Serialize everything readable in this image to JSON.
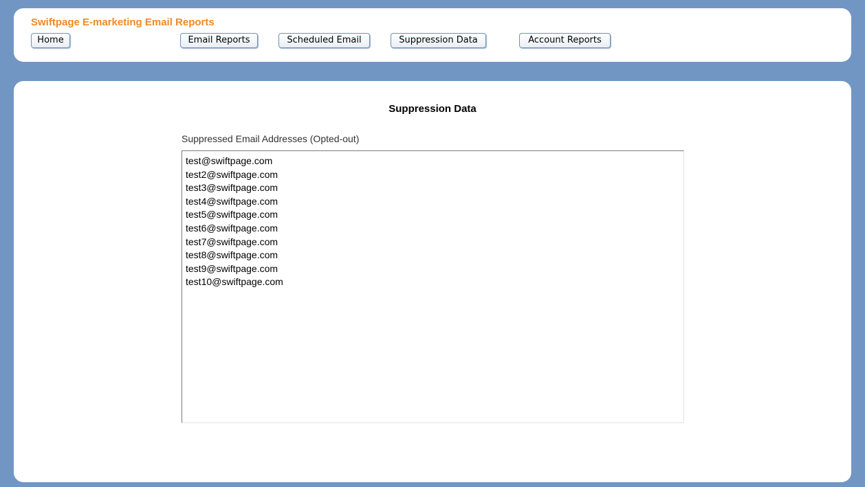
{
  "header": {
    "title": "Swiftpage E-marketing Email Reports",
    "nav": {
      "home": "Home",
      "email_reports": "Email Reports",
      "scheduled_email": "Scheduled Email",
      "suppression_data": "Suppression Data",
      "account_reports": "Account Reports"
    }
  },
  "main": {
    "title": "Suppression Data",
    "section_label": "Suppressed Email Addresses (Opted-out)",
    "emails": [
      "test@swiftpage.com",
      "test2@swiftpage.com",
      "test3@swiftpage.com",
      "test4@swiftpage.com",
      "test5@swiftpage.com",
      "test6@swiftpage.com",
      "test7@swiftpage.com",
      "test8@swiftpage.com",
      "test9@swiftpage.com",
      "test10@swiftpage.com"
    ]
  },
  "colors": {
    "page_background": "#7196c3",
    "title_accent": "#f08a24",
    "panel_background": "#ffffff"
  }
}
